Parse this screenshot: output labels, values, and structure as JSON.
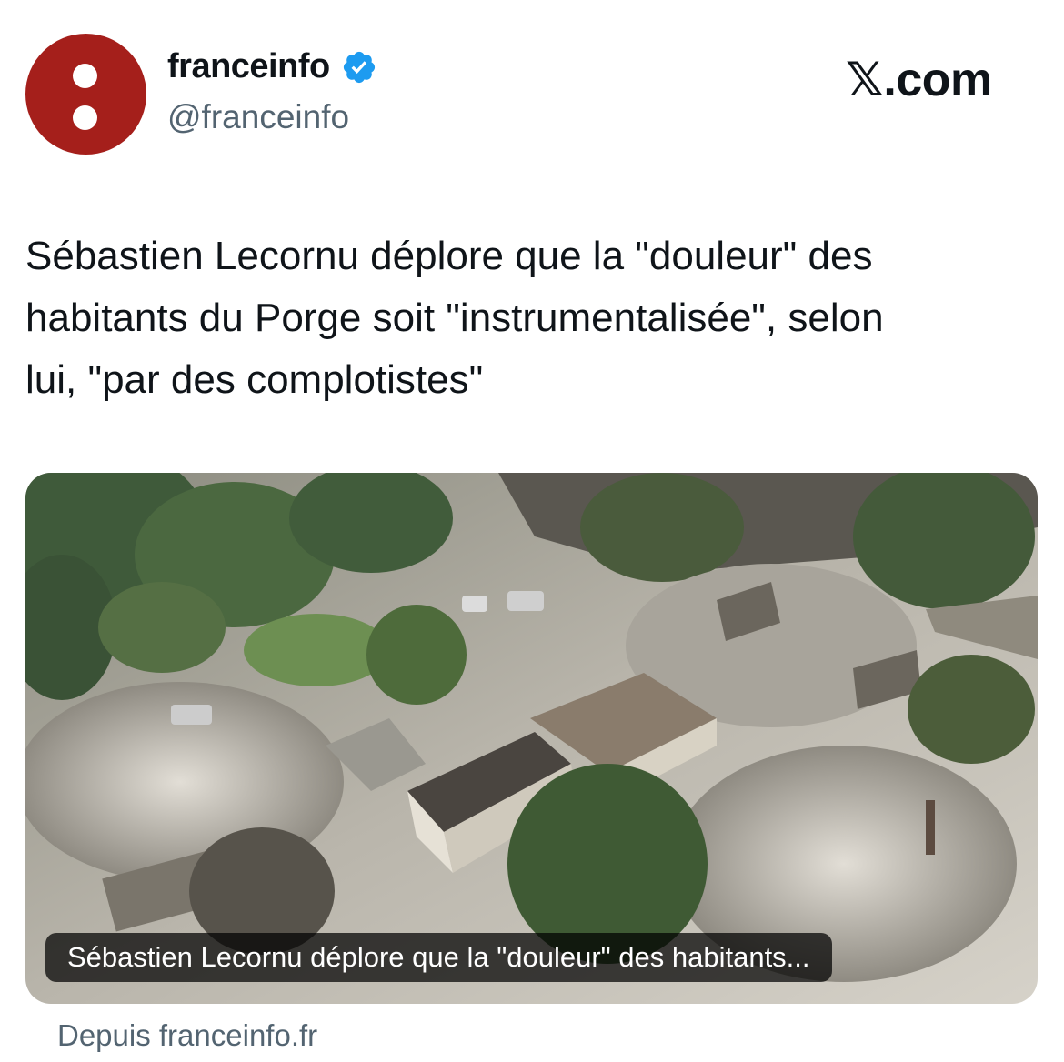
{
  "account": {
    "display_name": "franceinfo",
    "handle": "@franceinfo",
    "verified": true,
    "avatar_color": "#a51f1b",
    "verified_color": "#1d9bf0"
  },
  "watermark": "𝕏.com",
  "tweet": {
    "lines": [
      "Sébastien Lecornu déplore que la \"douleur\" des",
      "habitants du Porge soit \"instrumentalisée\", selon",
      "lui, \"par des complotistes\""
    ]
  },
  "card": {
    "caption": "Sébastien Lecornu déplore que la \"douleur\" des habitants...",
    "source": "Depuis franceinfo.fr"
  }
}
